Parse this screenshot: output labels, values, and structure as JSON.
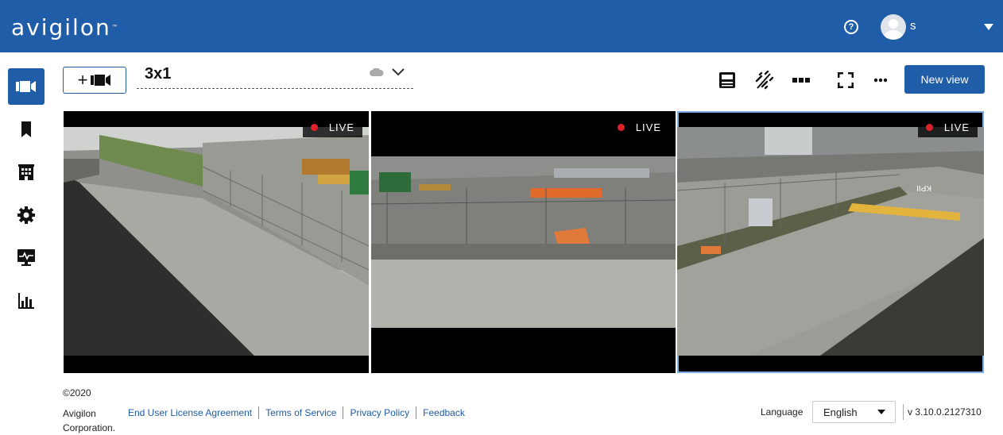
{
  "header": {
    "logo_text": "avigilon",
    "help_icon": "help-circle-icon",
    "user_initial": "s"
  },
  "sidebar": {
    "items": [
      {
        "name": "cameras",
        "icon": "video-camera-icon",
        "active": true
      },
      {
        "name": "bookmarks",
        "icon": "bookmark-icon",
        "active": false
      },
      {
        "name": "sites",
        "icon": "building-icon",
        "active": false
      },
      {
        "name": "settings",
        "icon": "gear-icon",
        "active": false
      },
      {
        "name": "health",
        "icon": "monitor-pulse-icon",
        "active": false
      },
      {
        "name": "reports",
        "icon": "bar-chart-icon",
        "active": false
      }
    ]
  },
  "toolbar": {
    "add_camera_label": "+",
    "view_name": "3x1",
    "new_view_label": "New view",
    "icons": [
      "save-icon",
      "unlink-icon",
      "layout-icon",
      "fullscreen-icon",
      "more-icon"
    ]
  },
  "tiles": [
    {
      "badge": "LIVE",
      "selected": false
    },
    {
      "badge": "LIVE",
      "selected": false
    },
    {
      "badge": "LIVE",
      "selected": true
    }
  ],
  "footer": {
    "copyright": "©2020",
    "company_line1": "Avigilon",
    "company_line2": "Corporation.",
    "links": [
      "End User License Agreement",
      "Terms of Service",
      "Privacy Policy",
      "Feedback"
    ],
    "language_label": "Language",
    "language_value": "English",
    "version": "v 3.10.0.2127310"
  },
  "colors": {
    "brand_blue": "#1f5da8",
    "live_red": "#e0212b",
    "selected_outline": "#7aaee6"
  }
}
